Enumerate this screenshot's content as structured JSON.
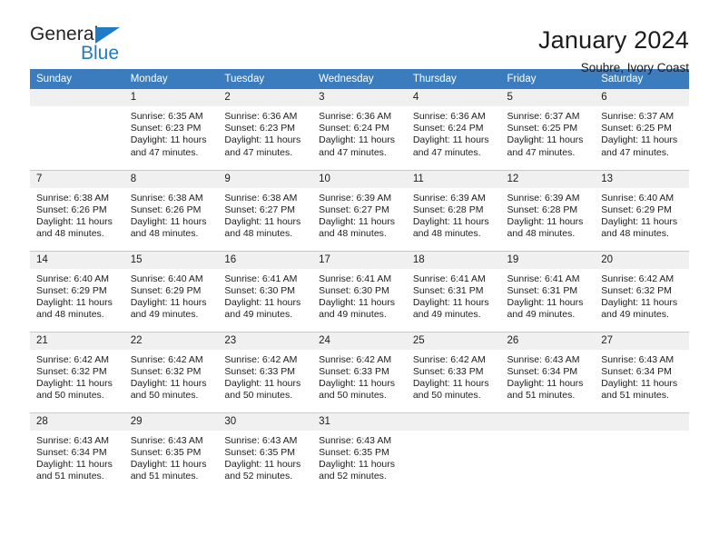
{
  "brand": {
    "name_part1": "General",
    "name_part2": "Blue",
    "triangle_color": "#1f7cc4"
  },
  "header": {
    "title": "January 2024",
    "subtitle": "Soubre, Ivory Coast"
  },
  "theme": {
    "header_bg": "#3a7cbe",
    "header_text": "#ffffff",
    "daynum_bg": "#f0f0f0",
    "grid_line": "#c8c8c8",
    "body_text": "#1c1c1c"
  },
  "weekdays": [
    "Sunday",
    "Monday",
    "Tuesday",
    "Wednesday",
    "Thursday",
    "Friday",
    "Saturday"
  ],
  "labels": {
    "sunrise": "Sunrise:",
    "sunset": "Sunset:",
    "daylight": "Daylight:"
  },
  "weeks": [
    [
      {
        "day": ""
      },
      {
        "day": "1",
        "sunrise": "Sunrise: 6:35 AM",
        "sunset": "Sunset: 6:23 PM",
        "daylight1": "Daylight: 11 hours",
        "daylight2": "and 47 minutes."
      },
      {
        "day": "2",
        "sunrise": "Sunrise: 6:36 AM",
        "sunset": "Sunset: 6:23 PM",
        "daylight1": "Daylight: 11 hours",
        "daylight2": "and 47 minutes."
      },
      {
        "day": "3",
        "sunrise": "Sunrise: 6:36 AM",
        "sunset": "Sunset: 6:24 PM",
        "daylight1": "Daylight: 11 hours",
        "daylight2": "and 47 minutes."
      },
      {
        "day": "4",
        "sunrise": "Sunrise: 6:36 AM",
        "sunset": "Sunset: 6:24 PM",
        "daylight1": "Daylight: 11 hours",
        "daylight2": "and 47 minutes."
      },
      {
        "day": "5",
        "sunrise": "Sunrise: 6:37 AM",
        "sunset": "Sunset: 6:25 PM",
        "daylight1": "Daylight: 11 hours",
        "daylight2": "and 47 minutes."
      },
      {
        "day": "6",
        "sunrise": "Sunrise: 6:37 AM",
        "sunset": "Sunset: 6:25 PM",
        "daylight1": "Daylight: 11 hours",
        "daylight2": "and 47 minutes."
      }
    ],
    [
      {
        "day": "7",
        "sunrise": "Sunrise: 6:38 AM",
        "sunset": "Sunset: 6:26 PM",
        "daylight1": "Daylight: 11 hours",
        "daylight2": "and 48 minutes."
      },
      {
        "day": "8",
        "sunrise": "Sunrise: 6:38 AM",
        "sunset": "Sunset: 6:26 PM",
        "daylight1": "Daylight: 11 hours",
        "daylight2": "and 48 minutes."
      },
      {
        "day": "9",
        "sunrise": "Sunrise: 6:38 AM",
        "sunset": "Sunset: 6:27 PM",
        "daylight1": "Daylight: 11 hours",
        "daylight2": "and 48 minutes."
      },
      {
        "day": "10",
        "sunrise": "Sunrise: 6:39 AM",
        "sunset": "Sunset: 6:27 PM",
        "daylight1": "Daylight: 11 hours",
        "daylight2": "and 48 minutes."
      },
      {
        "day": "11",
        "sunrise": "Sunrise: 6:39 AM",
        "sunset": "Sunset: 6:28 PM",
        "daylight1": "Daylight: 11 hours",
        "daylight2": "and 48 minutes."
      },
      {
        "day": "12",
        "sunrise": "Sunrise: 6:39 AM",
        "sunset": "Sunset: 6:28 PM",
        "daylight1": "Daylight: 11 hours",
        "daylight2": "and 48 minutes."
      },
      {
        "day": "13",
        "sunrise": "Sunrise: 6:40 AM",
        "sunset": "Sunset: 6:29 PM",
        "daylight1": "Daylight: 11 hours",
        "daylight2": "and 48 minutes."
      }
    ],
    [
      {
        "day": "14",
        "sunrise": "Sunrise: 6:40 AM",
        "sunset": "Sunset: 6:29 PM",
        "daylight1": "Daylight: 11 hours",
        "daylight2": "and 48 minutes."
      },
      {
        "day": "15",
        "sunrise": "Sunrise: 6:40 AM",
        "sunset": "Sunset: 6:29 PM",
        "daylight1": "Daylight: 11 hours",
        "daylight2": "and 49 minutes."
      },
      {
        "day": "16",
        "sunrise": "Sunrise: 6:41 AM",
        "sunset": "Sunset: 6:30 PM",
        "daylight1": "Daylight: 11 hours",
        "daylight2": "and 49 minutes."
      },
      {
        "day": "17",
        "sunrise": "Sunrise: 6:41 AM",
        "sunset": "Sunset: 6:30 PM",
        "daylight1": "Daylight: 11 hours",
        "daylight2": "and 49 minutes."
      },
      {
        "day": "18",
        "sunrise": "Sunrise: 6:41 AM",
        "sunset": "Sunset: 6:31 PM",
        "daylight1": "Daylight: 11 hours",
        "daylight2": "and 49 minutes."
      },
      {
        "day": "19",
        "sunrise": "Sunrise: 6:41 AM",
        "sunset": "Sunset: 6:31 PM",
        "daylight1": "Daylight: 11 hours",
        "daylight2": "and 49 minutes."
      },
      {
        "day": "20",
        "sunrise": "Sunrise: 6:42 AM",
        "sunset": "Sunset: 6:32 PM",
        "daylight1": "Daylight: 11 hours",
        "daylight2": "and 49 minutes."
      }
    ],
    [
      {
        "day": "21",
        "sunrise": "Sunrise: 6:42 AM",
        "sunset": "Sunset: 6:32 PM",
        "daylight1": "Daylight: 11 hours",
        "daylight2": "and 50 minutes."
      },
      {
        "day": "22",
        "sunrise": "Sunrise: 6:42 AM",
        "sunset": "Sunset: 6:32 PM",
        "daylight1": "Daylight: 11 hours",
        "daylight2": "and 50 minutes."
      },
      {
        "day": "23",
        "sunrise": "Sunrise: 6:42 AM",
        "sunset": "Sunset: 6:33 PM",
        "daylight1": "Daylight: 11 hours",
        "daylight2": "and 50 minutes."
      },
      {
        "day": "24",
        "sunrise": "Sunrise: 6:42 AM",
        "sunset": "Sunset: 6:33 PM",
        "daylight1": "Daylight: 11 hours",
        "daylight2": "and 50 minutes."
      },
      {
        "day": "25",
        "sunrise": "Sunrise: 6:42 AM",
        "sunset": "Sunset: 6:33 PM",
        "daylight1": "Daylight: 11 hours",
        "daylight2": "and 50 minutes."
      },
      {
        "day": "26",
        "sunrise": "Sunrise: 6:43 AM",
        "sunset": "Sunset: 6:34 PM",
        "daylight1": "Daylight: 11 hours",
        "daylight2": "and 51 minutes."
      },
      {
        "day": "27",
        "sunrise": "Sunrise: 6:43 AM",
        "sunset": "Sunset: 6:34 PM",
        "daylight1": "Daylight: 11 hours",
        "daylight2": "and 51 minutes."
      }
    ],
    [
      {
        "day": "28",
        "sunrise": "Sunrise: 6:43 AM",
        "sunset": "Sunset: 6:34 PM",
        "daylight1": "Daylight: 11 hours",
        "daylight2": "and 51 minutes."
      },
      {
        "day": "29",
        "sunrise": "Sunrise: 6:43 AM",
        "sunset": "Sunset: 6:35 PM",
        "daylight1": "Daylight: 11 hours",
        "daylight2": "and 51 minutes."
      },
      {
        "day": "30",
        "sunrise": "Sunrise: 6:43 AM",
        "sunset": "Sunset: 6:35 PM",
        "daylight1": "Daylight: 11 hours",
        "daylight2": "and 52 minutes."
      },
      {
        "day": "31",
        "sunrise": "Sunrise: 6:43 AM",
        "sunset": "Sunset: 6:35 PM",
        "daylight1": "Daylight: 11 hours",
        "daylight2": "and 52 minutes."
      },
      {
        "day": ""
      },
      {
        "day": ""
      },
      {
        "day": ""
      }
    ]
  ]
}
